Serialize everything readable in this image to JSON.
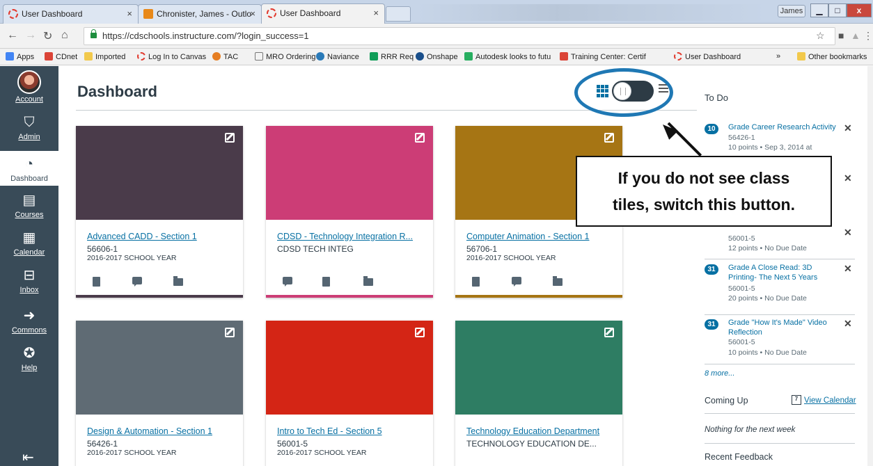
{
  "browser": {
    "tabs": [
      {
        "label": "User Dashboard",
        "icon": "canvas-icon"
      },
      {
        "label": "Chronister, James - Outlo",
        "icon": "outlook-icon"
      },
      {
        "label": "User Dashboard",
        "icon": "canvas-icon"
      }
    ],
    "user": "James",
    "url": "https://cdschools.instructure.com/?login_success=1",
    "bookmarks": [
      "Apps",
      "CDnet",
      "Imported",
      "Log In to Canvas",
      "TAC",
      "MRO Ordering",
      "Naviance",
      "RRR Req",
      "Onshape",
      "Autodesk looks to futu",
      "Training Center: Certif",
      "User Dashboard"
    ],
    "bookmarks_overflow": "»",
    "other_bookmarks": "Other bookmarks"
  },
  "nav": {
    "items": [
      {
        "label": "Account",
        "icon": "avatar"
      },
      {
        "label": "Admin",
        "icon": "shield-star-icon"
      },
      {
        "label": "Dashboard",
        "icon": "speedometer-icon"
      },
      {
        "label": "Courses",
        "icon": "book-icon"
      },
      {
        "label": "Calendar",
        "icon": "calendar-icon"
      },
      {
        "label": "Inbox",
        "icon": "inbox-icon"
      },
      {
        "label": "Commons",
        "icon": "commons-arrow-icon"
      },
      {
        "label": "Help",
        "icon": "help-gear-icon"
      }
    ],
    "active": "Dashboard"
  },
  "dashboard": {
    "title": "Dashboard",
    "view_toggle": "card-view",
    "cards": [
      {
        "title": "Advanced CADD - Section 1",
        "code": "56606-1",
        "term": "2016-2017 SCHOOL YEAR",
        "color": "#4a3b4a"
      },
      {
        "title": "CDSD - Technology Integration R...",
        "code": "CDSD TECH INTEG",
        "term": "",
        "color": "#cc3d76"
      },
      {
        "title": "Computer Animation - Section 1",
        "code": "56706-1",
        "term": "2016-2017 SCHOOL YEAR",
        "color": "#a67514"
      },
      {
        "title": "Design & Automation - Section 1",
        "code": "56426-1",
        "term": "2016-2017 SCHOOL YEAR",
        "color": "#5f6b74"
      },
      {
        "title": "Intro to Tech Ed - Section 5",
        "code": "56001-5",
        "term": "2016-2017 SCHOOL YEAR",
        "color": "#d42515"
      },
      {
        "title": "Technology Education Department",
        "code": "TECHNOLOGY EDUCATION DE...",
        "term": "",
        "color": "#2e7d63"
      }
    ]
  },
  "annotation": {
    "line1": "If you do not see class",
    "line2": "tiles, switch this button."
  },
  "todo": {
    "title": "To Do",
    "items": [
      {
        "badge": "10",
        "title": "Grade Career Research Activity",
        "line1": "56426-1",
        "line2": "10 points • Sep 3, 2014 at"
      },
      {
        "badge": "",
        "title": "",
        "line1": "56001-5",
        "line2": "12 points • No Due Date"
      },
      {
        "badge": "31",
        "title": "Grade A Close Read: 3D Printing- The Next 5 Years",
        "line1": "56001-5",
        "line2": "20 points • No Due Date"
      },
      {
        "badge": "31",
        "title": "Grade \"How It's Made\" Video Reflection",
        "line1": "56001-5",
        "line2": "10 points • No Due Date"
      }
    ],
    "more": "8 more...",
    "coming_up": "Coming Up",
    "calendar_day": "7",
    "view_calendar": "View Calendar",
    "nothing": "Nothing for the next week",
    "recent_feedback": "Recent Feedback"
  }
}
